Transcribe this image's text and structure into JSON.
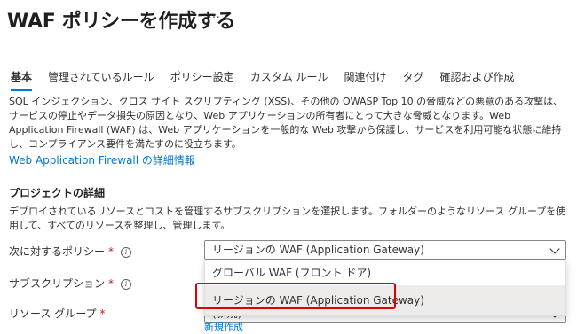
{
  "page": {
    "title": "WAF ポリシーを作成する",
    "more_label": "…"
  },
  "tabs": [
    {
      "label": "基本",
      "active": true
    },
    {
      "label": "管理されているルール",
      "active": false
    },
    {
      "label": "ポリシー設定",
      "active": false
    },
    {
      "label": "カスタム ルール",
      "active": false
    },
    {
      "label": "関連付け",
      "active": false
    },
    {
      "label": "タグ",
      "active": false
    },
    {
      "label": "確認および作成",
      "active": false
    }
  ],
  "description": "SQL インジェクション、クロス サイト スクリプティング (XSS)、その他の OWASP Top 10 の脅威などの悪意のある攻撃は、サービスの停止やデータ損失の原因となり、Web アプリケーションの所有者にとって大きな脅威となります。Web Application Firewall (WAF) は、Web アプリケーションを一般的な Web 攻撃から保護し、サービスを利用可能な状態に維持し、コンプライアンス要件を満たすのに役立ちます。",
  "learn_more_link": "Web Application Firewall の詳細情報",
  "project": {
    "section_title": "プロジェクトの詳細",
    "section_desc": "デプロイされているリソースとコストを管理するサブスクリプションを選択します。フォルダーのようなリソース グループを使用して、すべてのリソースを整理し、管理します。"
  },
  "fields": {
    "policy_for": {
      "label": "次に対するポリシー",
      "required_mark": "*",
      "info_icon": "i",
      "value": "リージョンの WAF (Application Gateway)",
      "options": [
        "グローバル WAF (フロント ドア)",
        "リージョンの WAF (Application Gateway)"
      ]
    },
    "subscription": {
      "label": "サブスクリプション",
      "required_mark": "*",
      "info_icon": "i"
    },
    "resource_group": {
      "label": "リソース グループ",
      "required_mark": "*",
      "partial_value": "(新規)",
      "create_new_link": "新規作成"
    }
  },
  "colors": {
    "accent": "#0078d4",
    "required": "#a4262c",
    "highlight": "#e00000"
  }
}
